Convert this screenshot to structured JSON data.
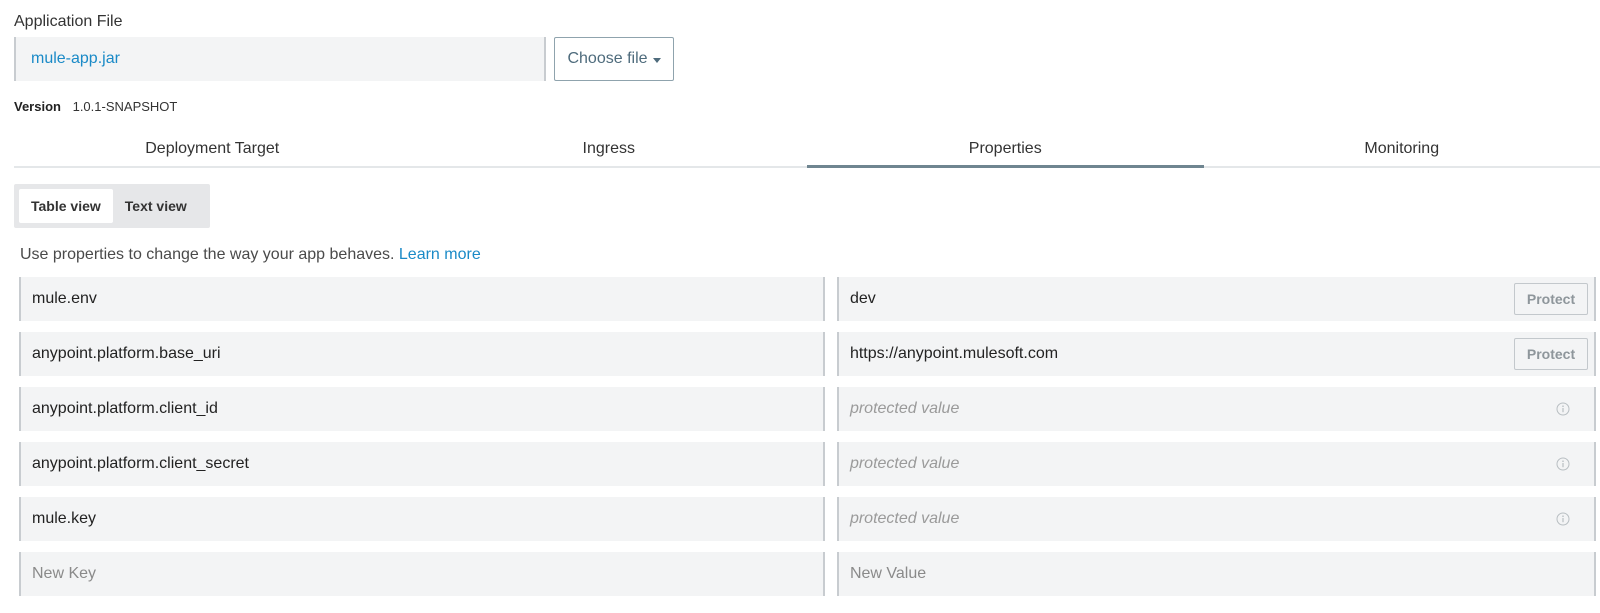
{
  "app_file": {
    "label": "Application File",
    "file_name": "mule-app.jar",
    "choose_label": "Choose file"
  },
  "version": {
    "label": "Version",
    "value": "1.0.1-SNAPSHOT"
  },
  "tabs": [
    {
      "label": "Deployment Target"
    },
    {
      "label": "Ingress"
    },
    {
      "label": "Properties",
      "active": true
    },
    {
      "label": "Monitoring"
    }
  ],
  "view_toggle": {
    "table": "Table view",
    "text": "Text view",
    "selected": "Table view"
  },
  "helper": {
    "text": "Use properties to change the way your app behaves.",
    "link": "Learn more"
  },
  "properties": [
    {
      "key": "mule.env",
      "value": "dev",
      "action": "Protect"
    },
    {
      "key": "anypoint.platform.base_uri",
      "value": "https://anypoint.mulesoft.com",
      "action": "Protect"
    },
    {
      "key": "anypoint.platform.client_id",
      "value": "protected value",
      "icon": "info-icon"
    },
    {
      "key": "anypoint.platform.client_secret",
      "value": "protected value",
      "icon": "info-icon"
    },
    {
      "key": "mule.key",
      "value": "protected value",
      "icon": "info-icon"
    }
  ],
  "new_row": {
    "key_placeholder": "New Key",
    "value_placeholder": "New Value"
  },
  "colors": {
    "link": "#1a8ac7",
    "active_tab": "#6f8590",
    "field_bg": "#f3f4f5"
  }
}
